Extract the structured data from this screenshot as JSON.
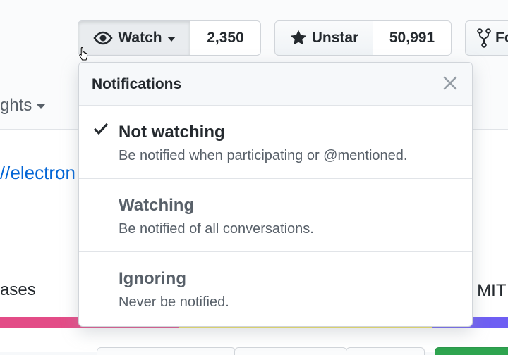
{
  "header": {
    "watch": {
      "label": "Watch",
      "count": "2,350",
      "icon": "eye-icon"
    },
    "star": {
      "label": "Unstar",
      "count": "50,991",
      "icon": "star-icon"
    },
    "fork": {
      "label": "Fo",
      "icon": "fork-icon"
    }
  },
  "background": {
    "insights_tab": "ghts",
    "homepage_link": "//electron",
    "releases": "ases",
    "license": "⚖ MIT"
  },
  "language_colors": [
    "#e34c87",
    "#f1e05a",
    "#6e5ef3"
  ],
  "dropdown": {
    "title": "Notifications",
    "close_icon": "close-icon",
    "items": [
      {
        "title": "Not watching",
        "description": "Be notified when participating or @mentioned.",
        "selected": true
      },
      {
        "title": "Watching",
        "description": "Be notified of all conversations.",
        "selected": false
      },
      {
        "title": "Ignoring",
        "description": "Never be notified.",
        "selected": false
      }
    ]
  }
}
